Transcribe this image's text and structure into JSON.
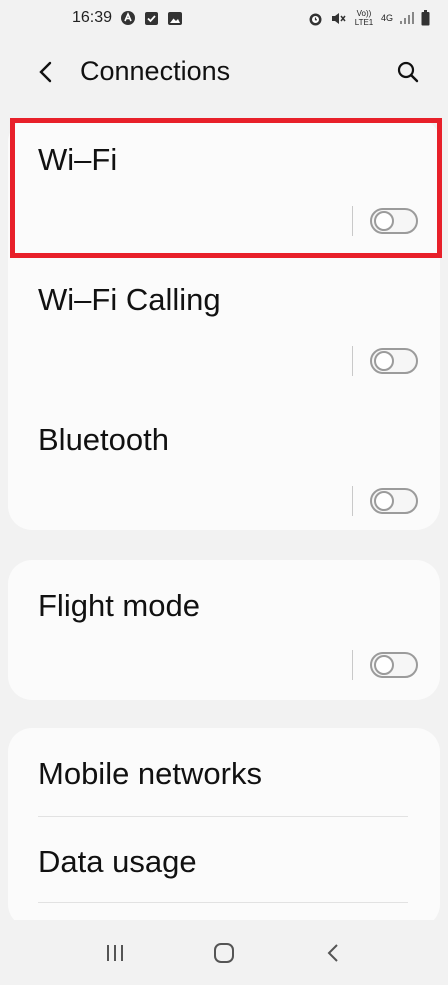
{
  "status_bar": {
    "time": "16:39",
    "network_label": "4G",
    "volte_label": "Vo)) LTE1"
  },
  "header": {
    "title": "Connections"
  },
  "settings": {
    "wifi": {
      "label": "Wi–Fi",
      "enabled": false
    },
    "wifi_calling": {
      "label": "Wi–Fi Calling",
      "enabled": false
    },
    "bluetooth": {
      "label": "Bluetooth",
      "enabled": false
    },
    "flight_mode": {
      "label": "Flight mode",
      "enabled": false
    },
    "mobile_networks": {
      "label": "Mobile networks"
    },
    "data_usage": {
      "label": "Data usage"
    }
  },
  "colors": {
    "highlight": "#e8202a",
    "card_background": "#fbfbfb",
    "page_background": "#f2f2f2"
  }
}
